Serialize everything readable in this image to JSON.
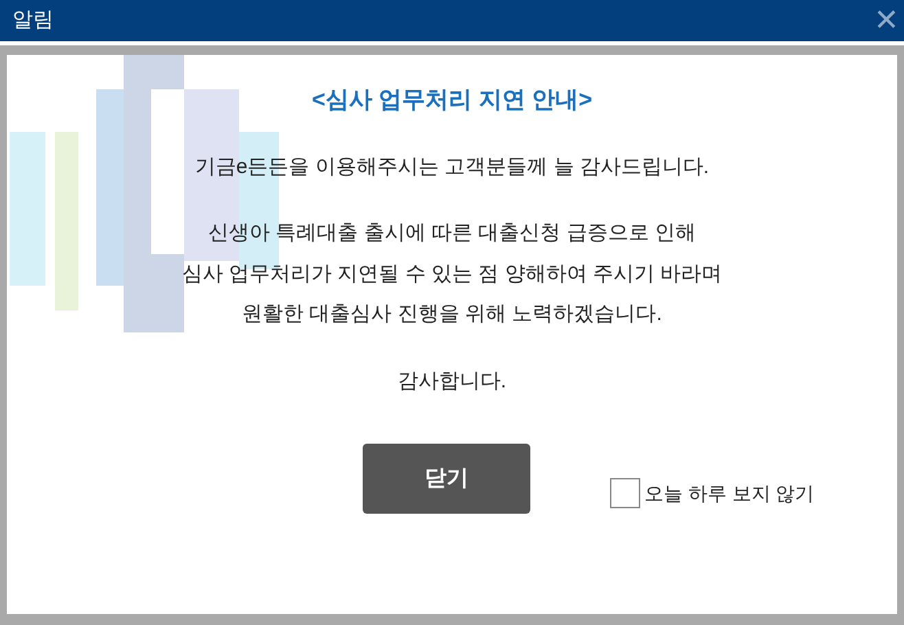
{
  "window": {
    "title": "알림",
    "close": "✕"
  },
  "notice": {
    "heading": "<심사 업무처리 지연 안내>",
    "paragraphs": [
      [
        "기금e든든을 이용해주시는 고객분들께 늘 감사드립니다."
      ],
      [
        "신생아 특례대출 출시에 따른 대출신청 급증으로 인해",
        "심사 업무처리가 지연될 수 있는 점 양해하여 주시기 바라며",
        "원활한 대출심사 진행을 위해 노력하겠습니다."
      ],
      [
        "감사합니다."
      ]
    ]
  },
  "close_button": "닫기",
  "dont_show_today": {
    "label": "오늘 하루 보지 않기",
    "checked": false
  }
}
